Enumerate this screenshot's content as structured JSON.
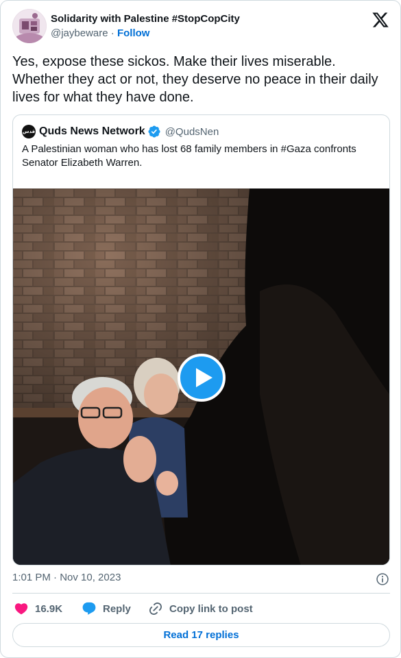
{
  "author": {
    "display_name": "Solidarity with Palestine #StopCopCity",
    "handle": "@jaybeware",
    "separator": " · ",
    "follow_label": "Follow",
    "avatar_icon": "avatar-illustration"
  },
  "tweet": {
    "text": "Yes, expose these sickos. Make their lives miserable. Whether they act or not, they deserve no peace in their daily lives for what they have done."
  },
  "quoted": {
    "display_name": "Quds News Network",
    "verified": true,
    "handle": "@QudsNen",
    "avatar_text": "قدس",
    "text": "A Palestinian woman who has lost 68 family members in #Gaza confronts Senator Elizabeth Warren.",
    "media": {
      "type": "video",
      "play_icon": "play-icon"
    }
  },
  "meta": {
    "timestamp": "1:01 PM · Nov 10, 2023"
  },
  "actions": {
    "like_count": "16.9K",
    "reply_label": "Reply",
    "copy_label": "Copy link to post"
  },
  "footer": {
    "read_replies": "Read 17 replies"
  },
  "colors": {
    "link": "#006fd6",
    "secondary_text": "#536471",
    "like": "#f91880",
    "reply": "#1d9bf0",
    "play_button": "#1d9bf0",
    "border": "#cfd9de"
  }
}
